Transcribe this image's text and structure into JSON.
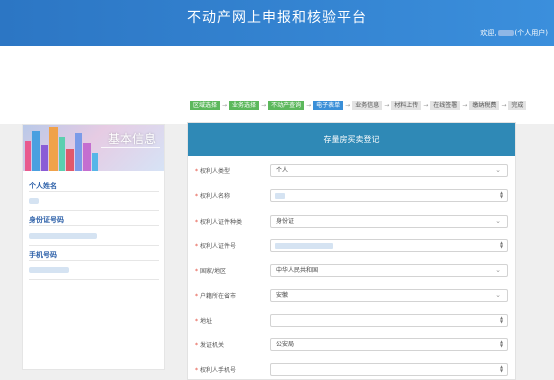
{
  "header": {
    "title": "不动产网上申报和核验平台",
    "welcome_prefix": "欢迎,",
    "welcome_suffix": "(个人用户)"
  },
  "steps": [
    {
      "label": "区域选择",
      "state": "done"
    },
    {
      "label": "业务选择",
      "state": "done"
    },
    {
      "label": "不动产查询",
      "state": "done"
    },
    {
      "label": "电子表单",
      "state": "current"
    },
    {
      "label": "业务信息",
      "state": "todo"
    },
    {
      "label": "材料上传",
      "state": "todo"
    },
    {
      "label": "在线签署",
      "state": "todo"
    },
    {
      "label": "缴纳税费",
      "state": "todo"
    },
    {
      "label": "完成",
      "state": "todo"
    }
  ],
  "sidebar": {
    "title": "基本信息",
    "fields": {
      "name_label": "个人姓名",
      "id_label": "身份证号码",
      "phone_label": "手机号码"
    }
  },
  "form": {
    "title": "存量房买卖登记",
    "rows": [
      {
        "label": "权利人类型",
        "required": true,
        "type": "select",
        "value": "个人"
      },
      {
        "label": "权利人名称",
        "required": true,
        "type": "text-blur",
        "value": ""
      },
      {
        "label": "权利人证件种类",
        "required": true,
        "type": "select",
        "value": "身份证"
      },
      {
        "label": "权利人证件号",
        "required": true,
        "type": "text-blur",
        "value": ""
      },
      {
        "label": "国家/地区",
        "required": true,
        "type": "select",
        "value": "中华人民共和国"
      },
      {
        "label": "户籍所在省市",
        "required": true,
        "type": "select",
        "value": "安徽"
      },
      {
        "label": "地址",
        "required": true,
        "type": "text",
        "value": ""
      },
      {
        "label": "发证机关",
        "required": true,
        "type": "text",
        "value": "公安局"
      },
      {
        "label": "权利人手机号",
        "required": true,
        "type": "text",
        "value": ""
      }
    ]
  },
  "colors": {
    "header": "#2c76c4",
    "panel_header": "#2f89b6",
    "step_done": "#5cb85c",
    "step_current": "#3a8fd8",
    "required_star": "#e24a3b",
    "sidebar_label": "#2b5fa8"
  }
}
